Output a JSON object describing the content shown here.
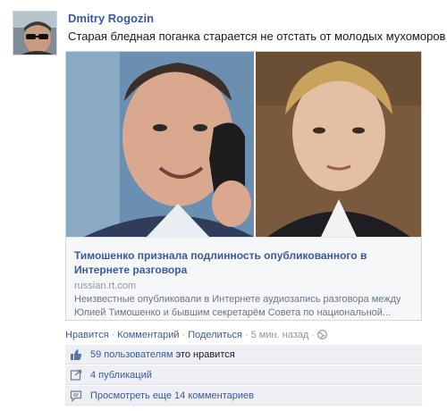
{
  "post": {
    "author": "Dmitry Rogozin",
    "message": "Старая бледная поганка старается не отстать от молодых мухоморов"
  },
  "share": {
    "title": "Тимошенко признала подлинность опубликованного в Интернете разговора",
    "domain": "russian.rt.com",
    "description": "Неизвестные опубликовали в Интернете аудиозапись разговора между Юлией Тимошенко и бывшим секретарём Совета по национальной..."
  },
  "actions": {
    "like": "Нравится",
    "comment": "Комментарий",
    "share": "Поделиться",
    "time": "5 мин. назад"
  },
  "ufi": {
    "likes_link": "59 пользователям",
    "likes_rest": " это нравится",
    "shares": "4 публикаций",
    "comments": "Просмотреть еще 14 комментариев"
  },
  "colors": {
    "link": "#3b5998",
    "ufi_bg": "#edeff4",
    "meta": "#90949c"
  },
  "icons": {
    "like": "thumbs-up-icon",
    "share": "share-icon",
    "comment": "comment-icon",
    "audience": "globe-icon"
  }
}
